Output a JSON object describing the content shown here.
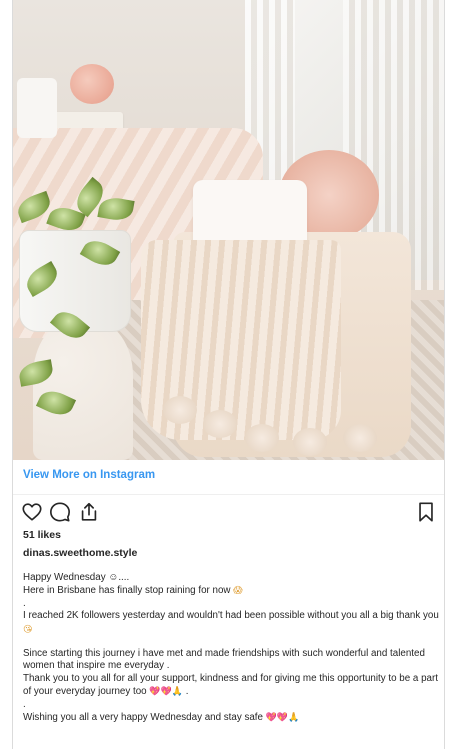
{
  "post": {
    "view_more_label": "View More on Instagram",
    "likes_text": "51 likes",
    "username": "dinas.sweethome.style"
  },
  "caption": {
    "line1": "Happy Wednesday ☺....",
    "line2": "Here in Brisbane has finally stop raining for now ",
    "line2_emoji": "😱",
    "dot1": ".",
    "line3": "I reached 2K followers yesterday and wouldn't had been possible without you all a big thank you ",
    "line3_emoji": "😘",
    "line4": "Since starting this journey i have met and made friendships with such wonderful and talented women that inspire me everyday .",
    "line5": "Thank you to you all for all your support, kindness and for giving me this opportunity to be a part of your everyday journey too ",
    "line5_emojis": "💖💖🙏",
    "line5_end": " .",
    "dot2": ".",
    "line6": "Wishing you all a very happy Wednesday and stay safe ",
    "line6_emojis": "💖💖🙏"
  },
  "icons": {
    "like": "heart-outline-icon",
    "comment": "comment-bubble-icon",
    "share": "share-upload-icon",
    "save": "bookmark-icon"
  },
  "colors": {
    "link": "#3897f0",
    "text": "#262626",
    "border": "#dbdbdb"
  }
}
